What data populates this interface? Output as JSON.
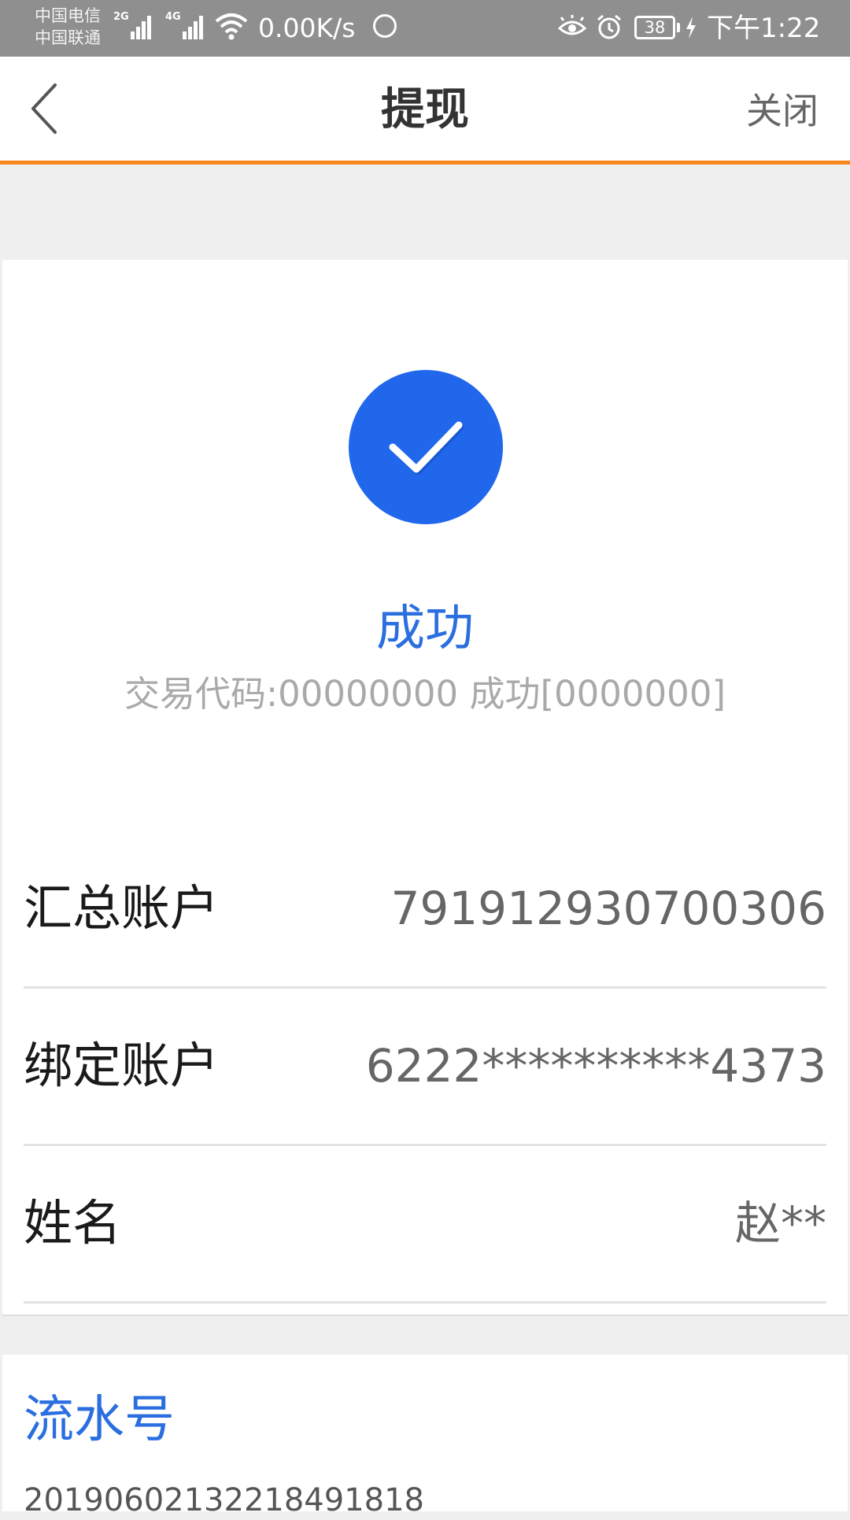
{
  "status_bar": {
    "carrier_1": "中国电信",
    "carrier_2": "中国联通",
    "sim1_network": "2G",
    "sim2_network": "4G",
    "net_speed": "0.00K/s",
    "battery": "38",
    "time": "下午1:22"
  },
  "header": {
    "title": "提现",
    "close_label": "关闭"
  },
  "result": {
    "status": "成功",
    "detail": "交易代码:00000000 成功[0000000]"
  },
  "details": [
    {
      "label": "汇总账户",
      "value": "791912930700306"
    },
    {
      "label": "绑定账户",
      "value": "6222**********4373"
    },
    {
      "label": "姓名",
      "value": "赵**"
    }
  ],
  "serial": {
    "label": "流水号",
    "value": "201906021322184918​18"
  },
  "colors": {
    "accent": "#f7861c",
    "success": "#2167ec",
    "link": "#2a6ee0"
  }
}
